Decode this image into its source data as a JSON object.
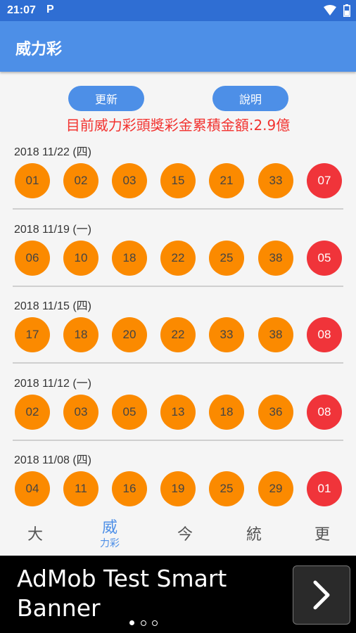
{
  "status_bar": {
    "time": "21:07",
    "notification": "P"
  },
  "app_bar": {
    "title": "威力彩"
  },
  "actions": {
    "refresh_label": "更新",
    "info_label": "說明"
  },
  "jackpot_text": "目前威力彩頭獎彩金累積金額:2.9億",
  "draws": [
    {
      "date": "2018 11/22 (四)",
      "numbers": [
        "01",
        "02",
        "03",
        "15",
        "21",
        "33"
      ],
      "special": "07"
    },
    {
      "date": "2018 11/19 (一)",
      "numbers": [
        "06",
        "10",
        "18",
        "22",
        "25",
        "38"
      ],
      "special": "05"
    },
    {
      "date": "2018 11/15 (四)",
      "numbers": [
        "17",
        "18",
        "20",
        "22",
        "33",
        "38"
      ],
      "special": "08"
    },
    {
      "date": "2018 11/12 (一)",
      "numbers": [
        "02",
        "03",
        "05",
        "13",
        "18",
        "36"
      ],
      "special": "08"
    },
    {
      "date": "2018 11/08 (四)",
      "numbers": [
        "04",
        "11",
        "16",
        "19",
        "25",
        "29"
      ],
      "special": "01"
    }
  ],
  "bottom_nav": [
    {
      "glyph": "大",
      "label": ""
    },
    {
      "glyph": "威",
      "label": "力彩"
    },
    {
      "glyph": "今",
      "label": ""
    },
    {
      "glyph": "統",
      "label": ""
    },
    {
      "glyph": "更",
      "label": ""
    }
  ],
  "ad_banner": {
    "text": "AdMob Test Smart Banner",
    "arrow_icon": "chevron-right-icon"
  },
  "colors": {
    "primary": "#4d8fe7",
    "status_bar": "#2f6ed3",
    "ball_normal": "#fb8a00",
    "ball_special": "#f0343a",
    "jackpot_text": "#f2322f"
  }
}
